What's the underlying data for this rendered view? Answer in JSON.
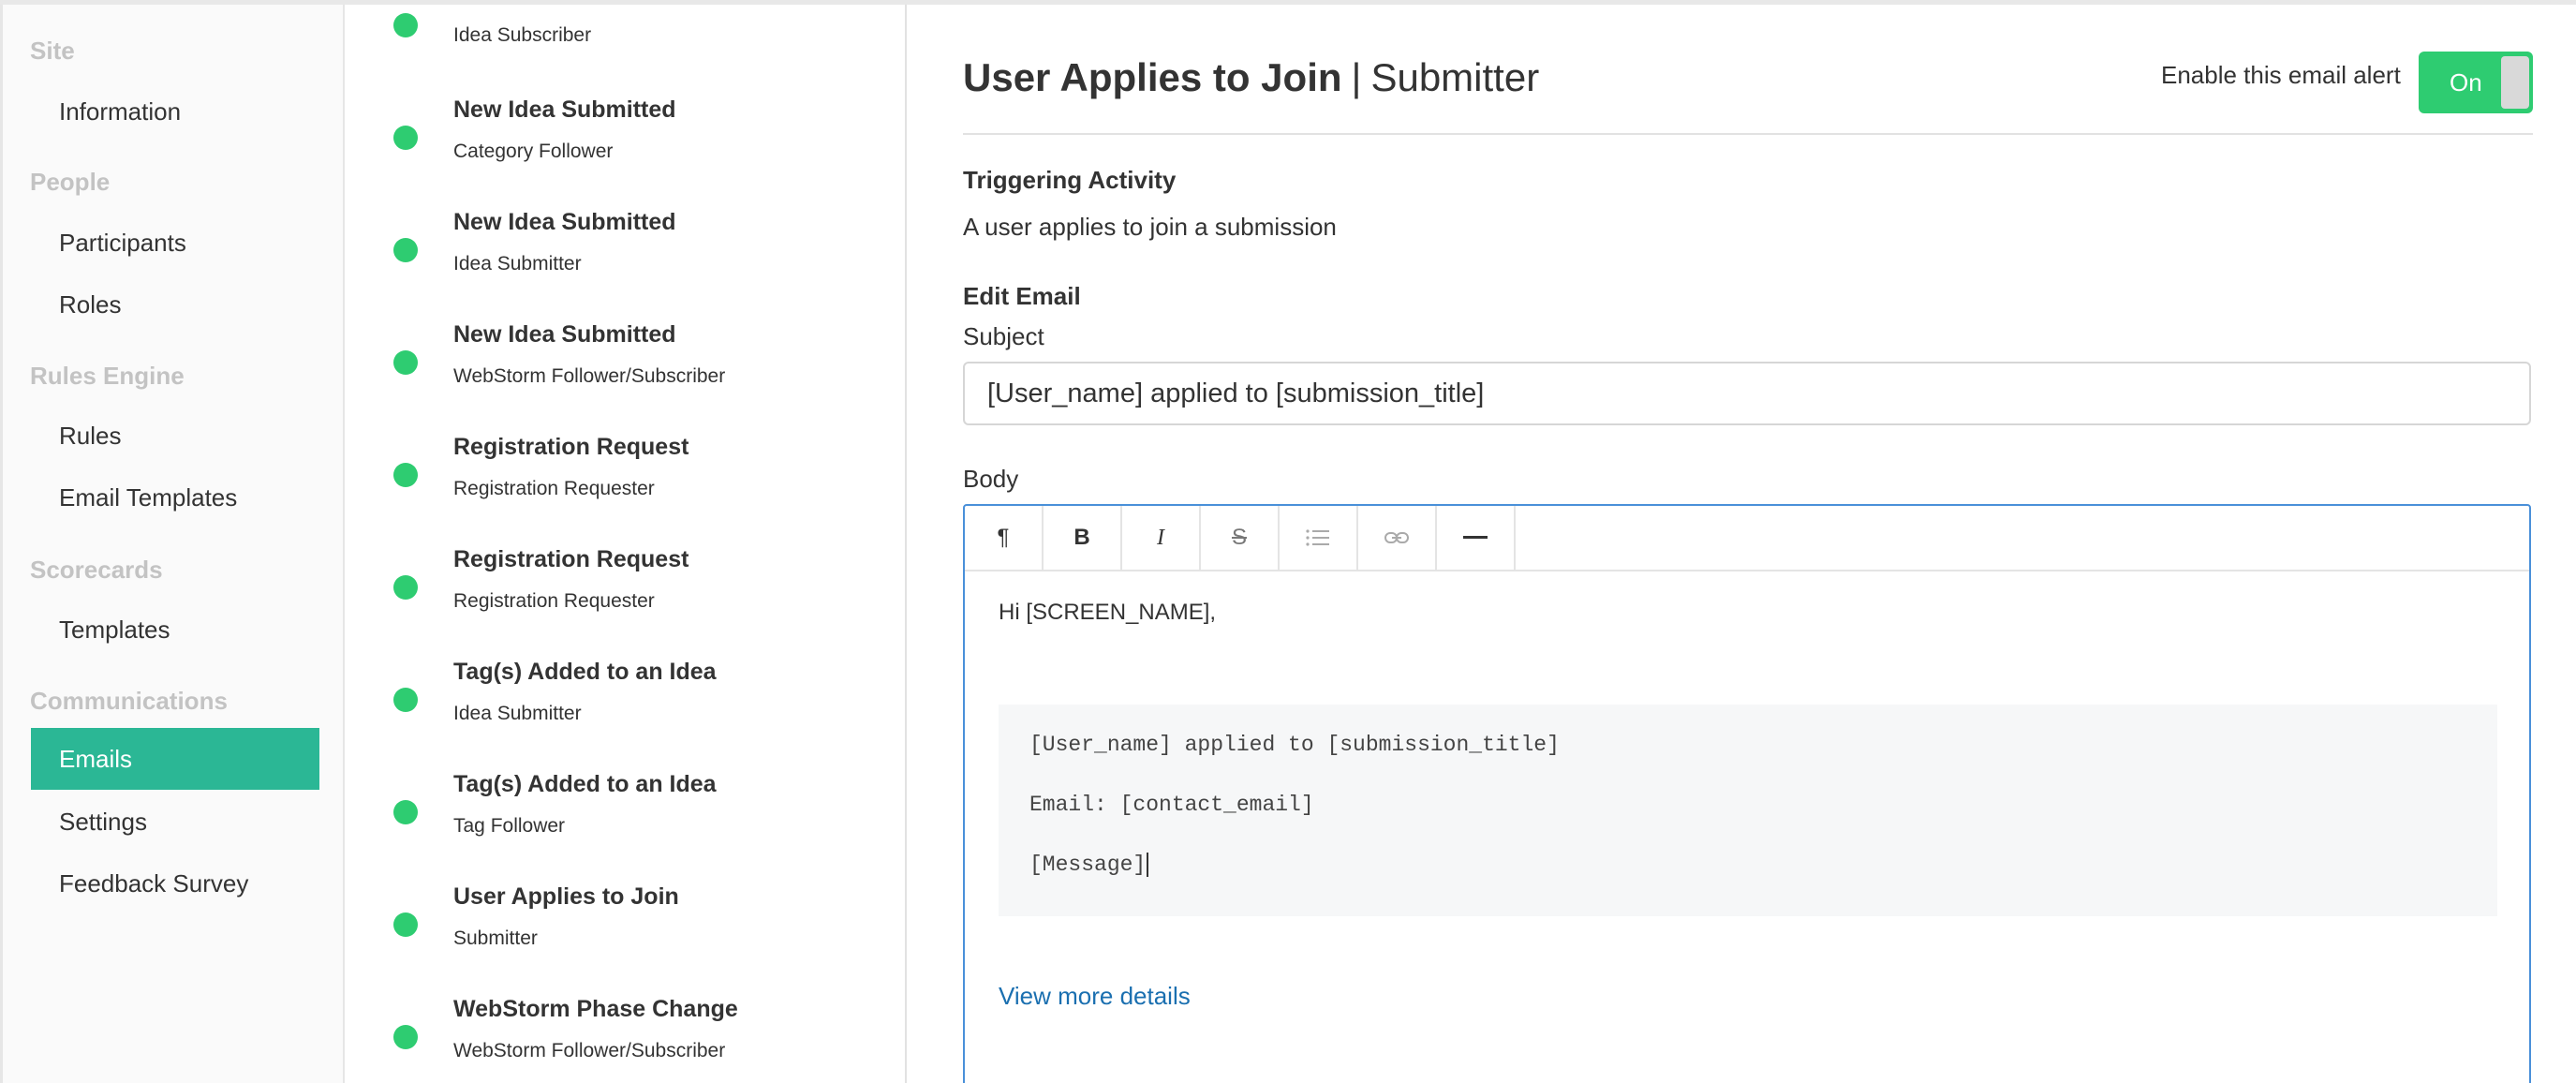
{
  "sidebar": {
    "sections": [
      {
        "label": "Site",
        "items": [
          {
            "label": "Information",
            "active": false
          }
        ]
      },
      {
        "label": "People",
        "items": [
          {
            "label": "Participants",
            "active": false
          },
          {
            "label": "Roles",
            "active": false
          }
        ]
      },
      {
        "label": "Rules Engine",
        "items": [
          {
            "label": "Rules",
            "active": false
          },
          {
            "label": "Email Templates",
            "active": false
          }
        ]
      },
      {
        "label": "Scorecards",
        "items": [
          {
            "label": "Templates",
            "active": false
          }
        ]
      },
      {
        "label": "Communications",
        "items": [
          {
            "label": "Emails",
            "active": true
          },
          {
            "label": "Settings",
            "active": false
          },
          {
            "label": "Feedback Survey",
            "active": false
          }
        ]
      }
    ]
  },
  "email_list": {
    "items": [
      {
        "title": "",
        "subtitle": "Idea Subscriber"
      },
      {
        "title": "New Idea Submitted",
        "subtitle": "Category Follower"
      },
      {
        "title": "New Idea Submitted",
        "subtitle": "Idea Submitter"
      },
      {
        "title": "New Idea Submitted",
        "subtitle": "WebStorm Follower/Subscriber"
      },
      {
        "title": "Registration Request",
        "subtitle": "Registration Requester"
      },
      {
        "title": "Registration Request",
        "subtitle": "Registration Requester"
      },
      {
        "title": "Tag(s) Added to an Idea",
        "subtitle": "Idea Submitter"
      },
      {
        "title": "Tag(s) Added to an Idea",
        "subtitle": "Tag Follower"
      },
      {
        "title": "User Applies to Join",
        "subtitle": "Submitter"
      },
      {
        "title": "WebStorm Phase Change",
        "subtitle": "WebStorm Follower/Subscriber"
      }
    ],
    "status_color": "#2ecc71"
  },
  "main": {
    "title": "User Applies to Join",
    "title_separator": "|",
    "title_role": "Submitter",
    "alert_label": "Enable this email alert",
    "toggle_label": "On",
    "toggle_on": true,
    "triggering_heading": "Triggering Activity",
    "triggering_text": "A user applies to join a submission",
    "edit_heading": "Edit Email",
    "subject_label": "Subject",
    "subject_value": "[User_name] applied to [submission_title]",
    "body_label": "Body",
    "toolbar": [
      {
        "icon": "paragraph-icon",
        "glyph": "¶"
      },
      {
        "icon": "bold-icon",
        "glyph": "B"
      },
      {
        "icon": "italic-icon",
        "glyph": "I"
      },
      {
        "icon": "strikethrough-icon",
        "glyph": "S"
      },
      {
        "icon": "bullet-list-icon",
        "glyph": ""
      },
      {
        "icon": "link-icon",
        "glyph": ""
      },
      {
        "icon": "horizontal-rule-icon",
        "glyph": ""
      }
    ],
    "body": {
      "greeting": "Hi [SCREEN_NAME],",
      "code_lines": [
        "[User_name] applied to [submission_title]",
        "Email: [contact_email]",
        "[Message]"
      ],
      "link_text": "View more details"
    },
    "accent_color": "#2bb795",
    "link_color": "#1a6fb0"
  }
}
